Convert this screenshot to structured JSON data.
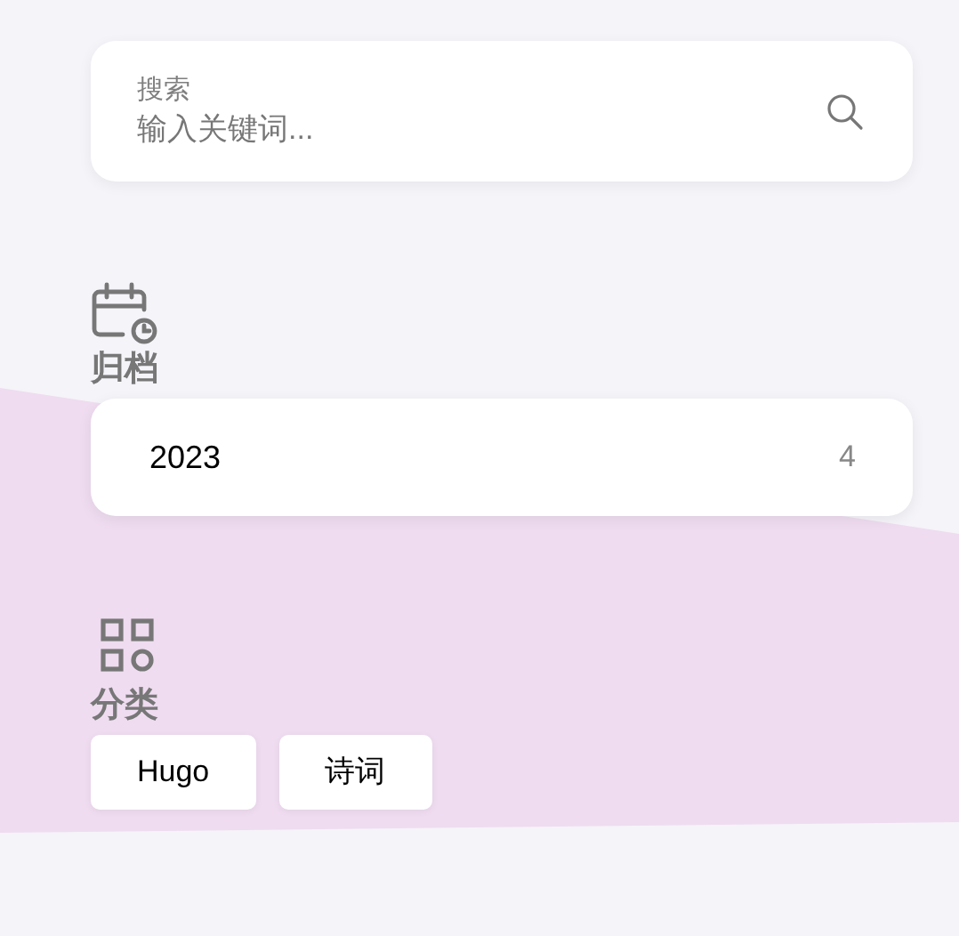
{
  "search": {
    "label": "搜索",
    "placeholder": "输入关键词..."
  },
  "archives": {
    "title": "归档",
    "items": [
      {
        "year": "2023",
        "count": "4"
      }
    ]
  },
  "categories": {
    "title": "分类",
    "tags": [
      "Hugo",
      "诗词"
    ]
  }
}
